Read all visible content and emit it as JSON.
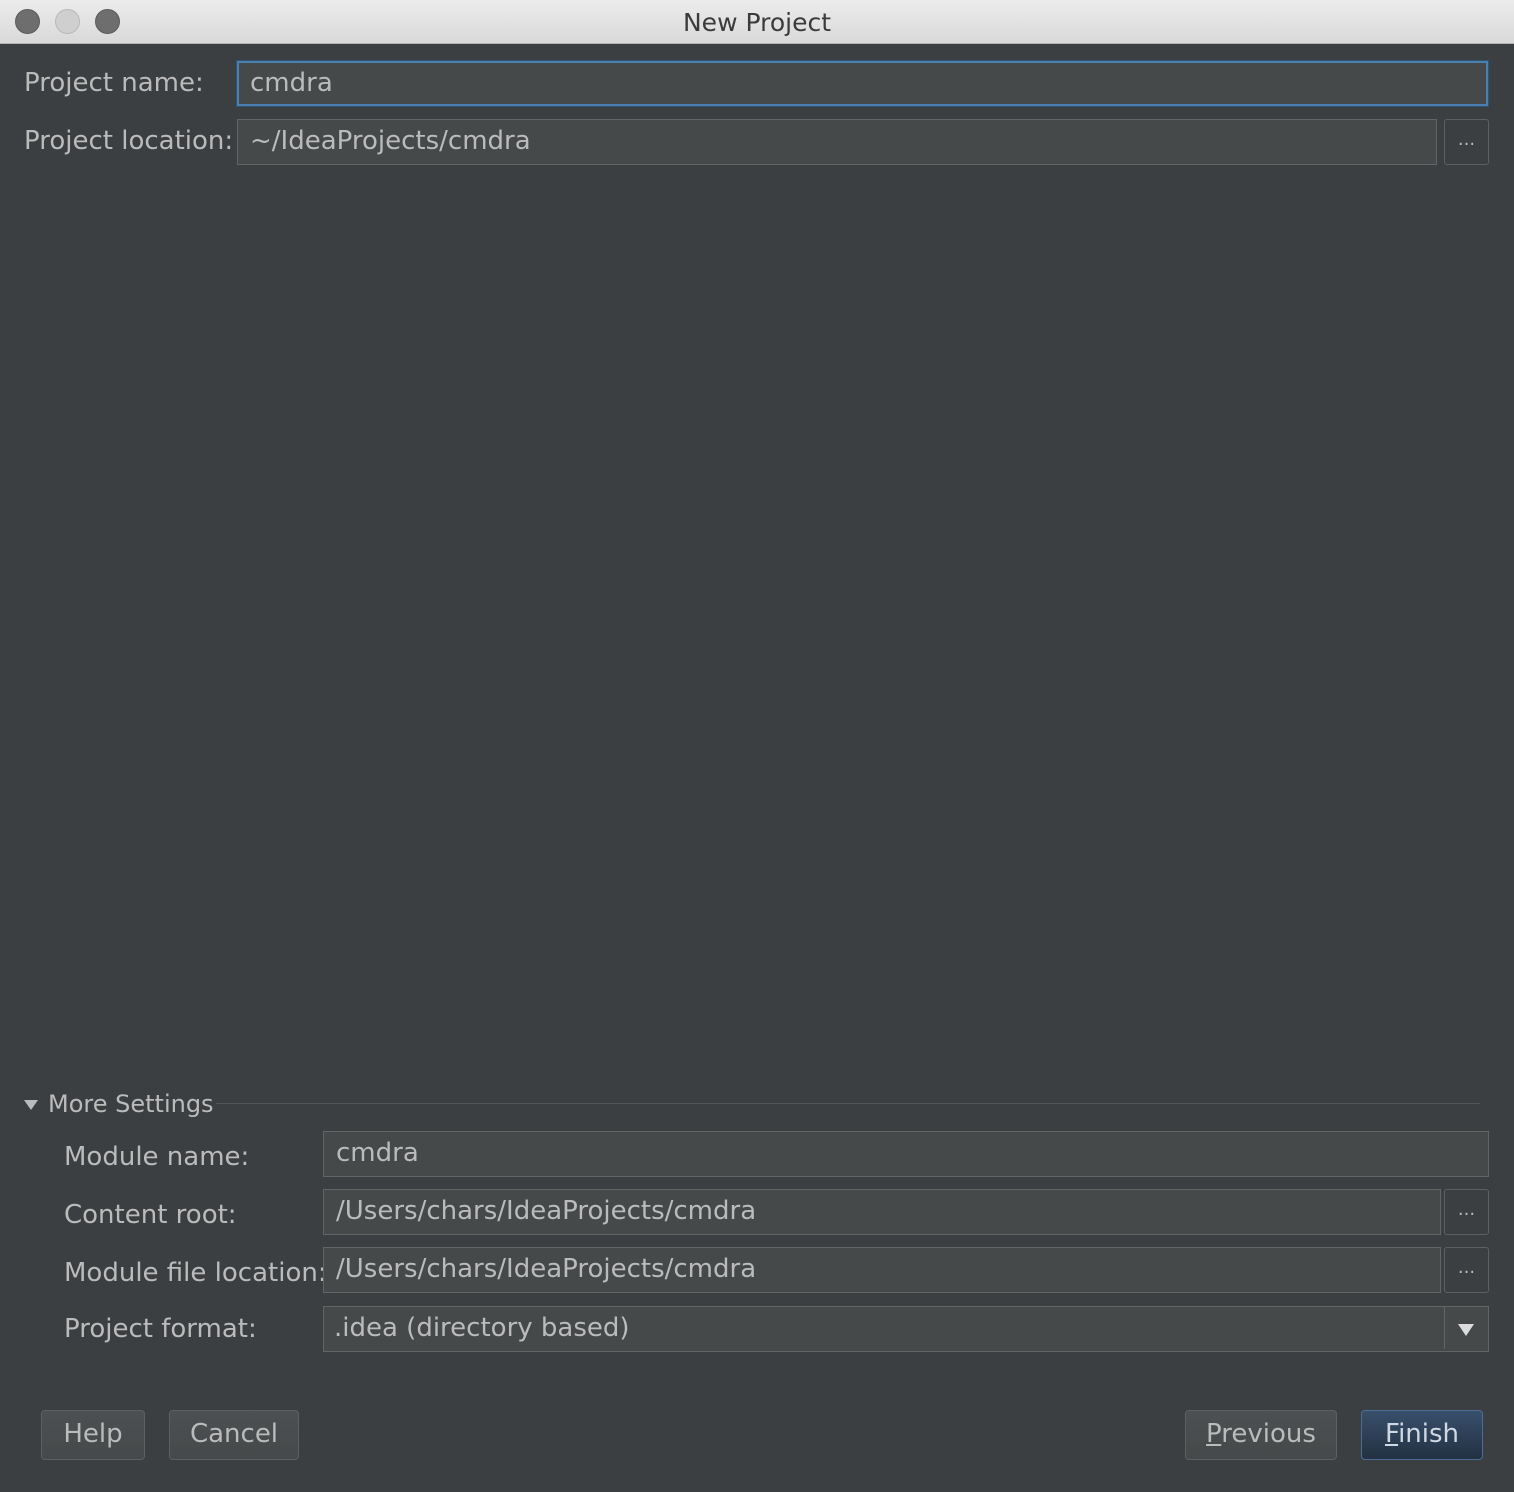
{
  "window": {
    "title": "New Project",
    "controls": [
      "close",
      "minimize",
      "zoom"
    ]
  },
  "form": {
    "project_name_label": "Project name:",
    "project_name_value": "cmdra",
    "project_location_label": "Project location:",
    "project_location_value": "~/IdeaProjects/cmdra",
    "browse_label": "..."
  },
  "more_settings": {
    "title": "More Settings",
    "expanded": true,
    "module_name_label": "Module name:",
    "module_name_value": "cmdra",
    "content_root_label": "Content root:",
    "content_root_value": "/Users/chars/IdeaProjects/cmdra",
    "module_file_location_label": "Module file location:",
    "module_file_location_value": "/Users/chars/IdeaProjects/cmdra",
    "project_format_label": "Project format:",
    "project_format_value": ".idea (directory based)"
  },
  "buttons": {
    "help": "Help",
    "cancel": "Cancel",
    "previous_mnemonic": "P",
    "previous_rest": "revious",
    "finish_mnemonic": "F",
    "finish_rest": "inish"
  },
  "colors": {
    "background": "#3c3f41",
    "field_background": "#45494a",
    "focus_border": "#4a7fb0",
    "default_button": "#2f4560"
  }
}
